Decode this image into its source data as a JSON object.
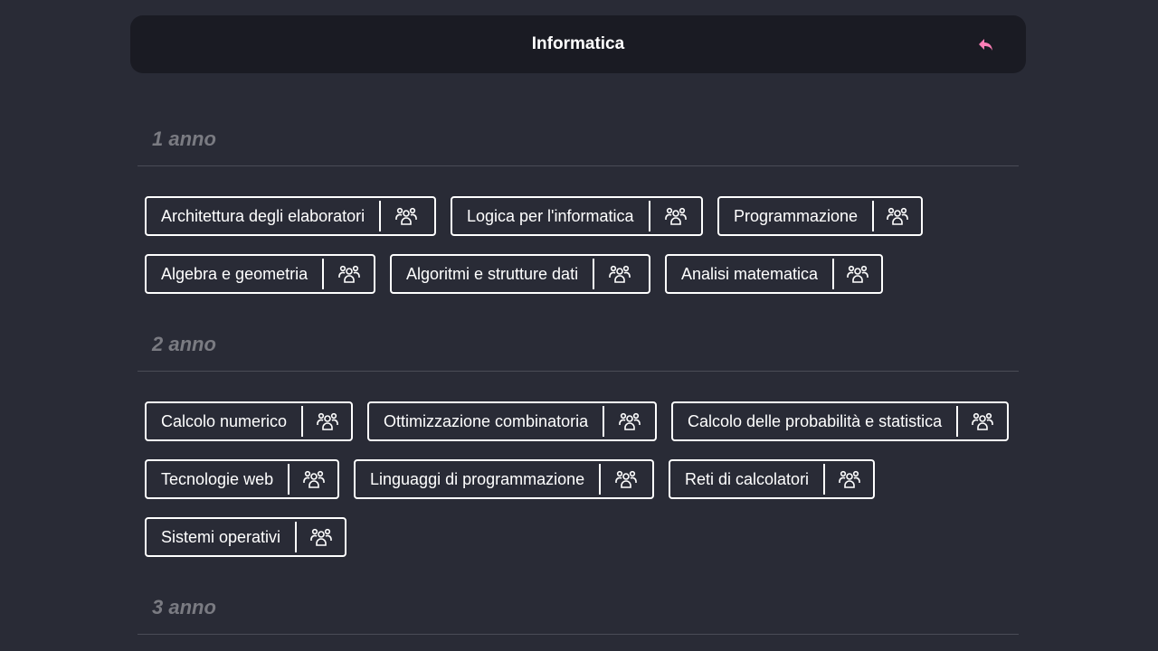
{
  "header": {
    "title": "Informatica",
    "back_icon": "reply-arrow-icon",
    "accent_color": "#ff7eb6"
  },
  "years": [
    {
      "title": "1 anno",
      "rows": [
        [
          "Architettura degli elaboratori",
          "Logica per l'informatica",
          "Programmazione"
        ],
        [
          "Algebra e geometria",
          "Algoritmi e strutture dati",
          "Analisi matematica"
        ]
      ]
    },
    {
      "title": "2 anno",
      "rows": [
        [
          "Calcolo numerico",
          "Ottimizzazione combinatoria",
          "Calcolo delle probabilità e statistica"
        ],
        [
          "Tecnologie web",
          "Linguaggi di programmazione",
          "Reti di calcolatori"
        ],
        [
          "Sistemi operativi"
        ]
      ]
    },
    {
      "title": "3 anno",
      "rows": []
    }
  ],
  "course_icon": "users-group-icon"
}
